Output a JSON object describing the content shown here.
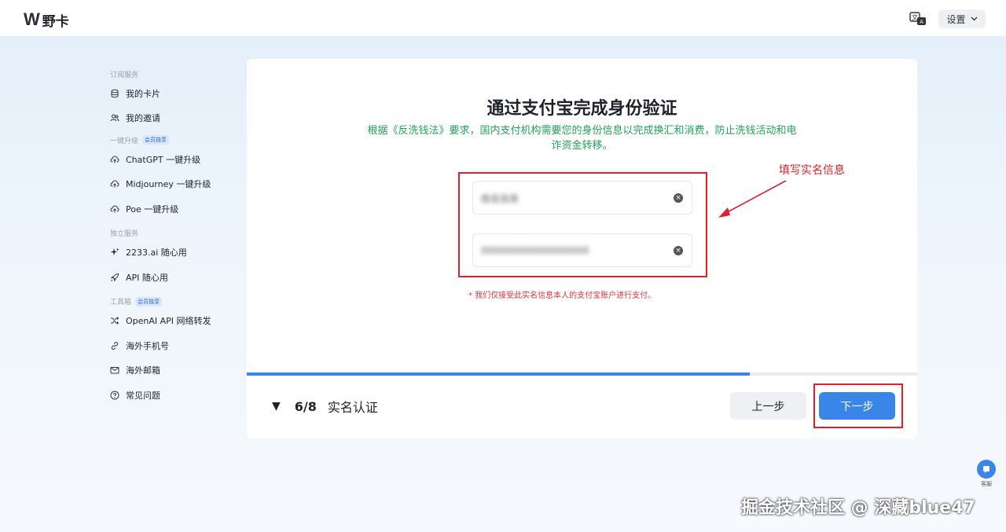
{
  "header": {
    "logo_mark": "W",
    "logo_text": "野卡",
    "settings_label": "设置"
  },
  "sidebar": {
    "sections": [
      {
        "title": "订阅服务",
        "badge": "",
        "items": [
          {
            "label": "我的卡片",
            "icon": "coins-icon"
          },
          {
            "label": "我的邀请",
            "icon": "users-icon"
          }
        ]
      },
      {
        "title": "一键升级",
        "badge": "会员独享",
        "items": [
          {
            "label": "ChatGPT 一键升级",
            "icon": "cloud-upload-icon"
          },
          {
            "label": "Midjourney 一键升级",
            "icon": "cloud-upload-icon"
          },
          {
            "label": "Poe 一键升级",
            "icon": "cloud-upload-icon"
          }
        ]
      },
      {
        "title": "独立服务",
        "badge": "",
        "items": [
          {
            "label": "2233.ai 随心用",
            "icon": "sparkle-icon"
          },
          {
            "label": "API 随心用",
            "icon": "rocket-icon"
          }
        ]
      },
      {
        "title": "工具箱",
        "badge": "会员独享",
        "items": [
          {
            "label": "OpenAI API 网络转发",
            "icon": "shuffle-icon"
          },
          {
            "label": "海外手机号",
            "icon": "link-icon"
          },
          {
            "label": "海外邮箱",
            "icon": "mail-icon"
          },
          {
            "label": "常见问题",
            "icon": "help-circle-icon"
          }
        ]
      }
    ]
  },
  "main": {
    "title": "通过支付宝完成身份验证",
    "subtitle": "根据《反洗钱法》要求，国内支付机构需要您的身份信息以完成换汇和消费，防止洗钱活动和电诈资金转移。",
    "name_value": "姓名信息",
    "id_value": "000000000000000000",
    "note": "* 我们仅接受此实名信息本人的支付宝账户进行支付。",
    "annotation": "填写实名信息",
    "progress_fraction": 0.75
  },
  "footer": {
    "step_indicator": "▼",
    "step_number": "6/8",
    "step_label": "实名认证",
    "prev_label": "上一步",
    "next_label": "下一步"
  },
  "support": {
    "label": "客服"
  },
  "watermark": "掘金技术社区 @ 深藏blue47",
  "colors": {
    "accent": "#3a86e8",
    "success_text": "#22a35a",
    "annotation_red": "#e0202a"
  }
}
